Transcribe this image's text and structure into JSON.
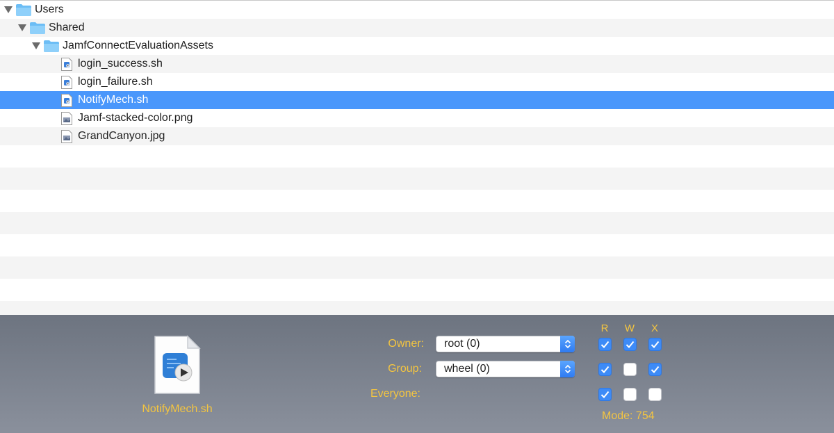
{
  "tree": {
    "items": [
      {
        "label": "Users",
        "type": "folder"
      },
      {
        "label": "Shared",
        "type": "folder"
      },
      {
        "label": "JamfConnectEvaluationAssets",
        "type": "folder"
      },
      {
        "label": "login_success.sh",
        "type": "script"
      },
      {
        "label": "login_failure.sh",
        "type": "script"
      },
      {
        "label": "NotifyMech.sh",
        "type": "script",
        "selected": true
      },
      {
        "label": "Jamf-stacked-color.png",
        "type": "image"
      },
      {
        "label": "GrandCanyon.jpg",
        "type": "image"
      }
    ]
  },
  "panel": {
    "file_name": "NotifyMech.sh",
    "owner_label": "Owner:",
    "owner_value": "root (0)",
    "group_label": "Group:",
    "group_value": "wheel (0)",
    "everyone_label": "Everyone:",
    "columns": [
      "R",
      "W",
      "X"
    ],
    "permissions": {
      "owner": [
        true,
        true,
        true
      ],
      "group": [
        true,
        false,
        true
      ],
      "everyone": [
        true,
        false,
        false
      ]
    },
    "mode_text": "Mode: 754"
  },
  "colors": {
    "selection": "#4a97fb",
    "accent_text": "#f4c540",
    "checkbox_on": "#3d8bf7"
  }
}
